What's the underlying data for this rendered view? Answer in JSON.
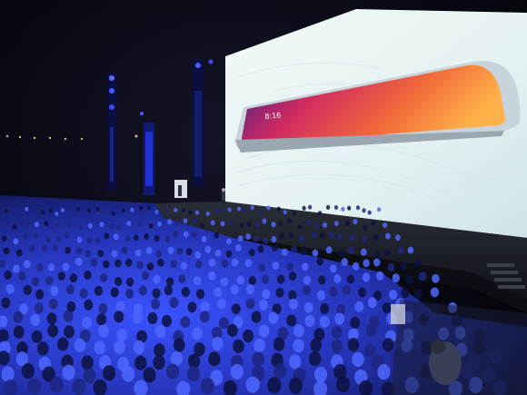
{
  "scene": {
    "description_free": true,
    "colors": {
      "background": "#05050c",
      "screen": "#e8f3f3",
      "stage": "#1a1e28",
      "audience": "#2a3fc8",
      "stage_light": "#3b4cff"
    }
  },
  "phone_screen": {
    "time_text": "8:16"
  }
}
